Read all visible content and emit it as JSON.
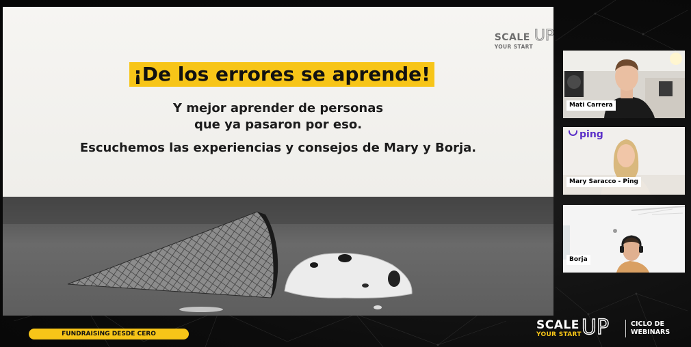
{
  "slide": {
    "logo_scale": "SCALE",
    "logo_up": "UP",
    "logo_sub": "YOUR START",
    "headline": "¡De los errores se aprende!",
    "line1": "Y mejor aprender de personas",
    "line2": "que ya pasaron por eso.",
    "line3": "Escuchemos las experiencias y consejos de Mary y Borja."
  },
  "participants": [
    {
      "name": "Mati Carrera"
    },
    {
      "name": "Mary Saracco - Ping",
      "logo": "ping"
    },
    {
      "name": "Borja"
    }
  ],
  "footer": {
    "pill_label": "FUNDRAISING DESDE CERO",
    "brand_scale": "SCALE",
    "brand_up": "UP",
    "brand_sub": "YOUR START",
    "series_line1": "CICLO DE",
    "series_line2": "WEBINARS"
  },
  "colors": {
    "accent_yellow": "#f7c518",
    "background": "#0b0b0b",
    "ping_purple": "#5b2fc8"
  }
}
